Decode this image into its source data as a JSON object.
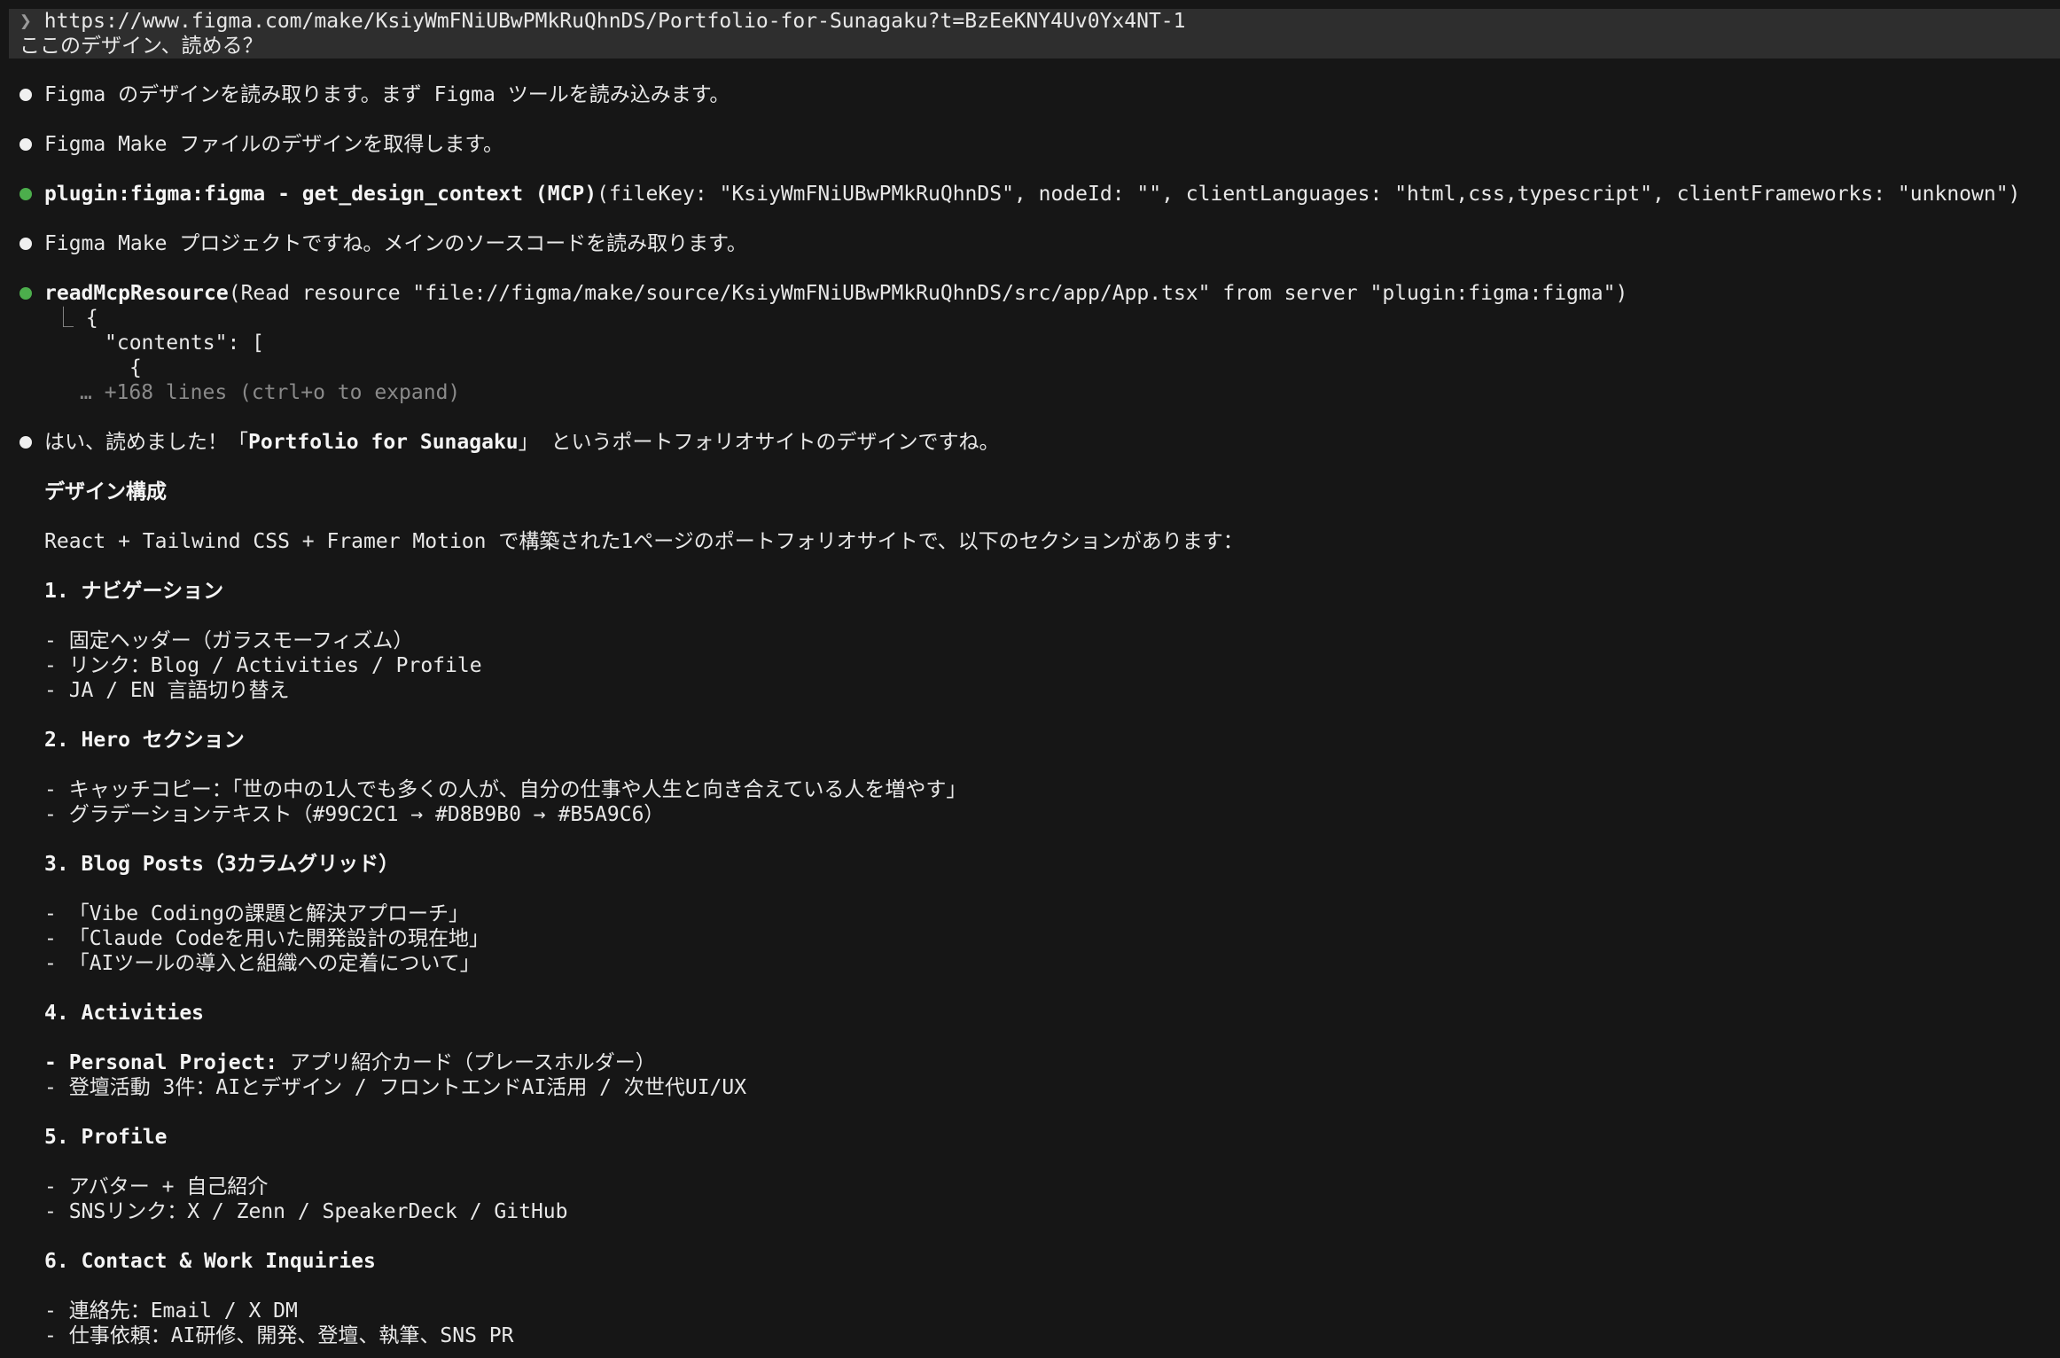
{
  "prompt": {
    "chevron": "❯",
    "url": "https://www.figma.com/make/KsiyWmFNiUBwPMkRuQhnDS/Portfolio-for-Sunagaku?t=BzEeKNY4Uv0Yx4NT-1",
    "question": "ここのデザイン、読める？"
  },
  "messages": [
    "Figma のデザインを読み取ります。まず Figma ツールを読み込みます。",
    "Figma Make ファイルのデザインを取得します。",
    "Figma Make プロジェクトですね。メインのソースコードを読み取ります。"
  ],
  "tool1": {
    "name": "plugin:figma:figma - get_design_context (MCP)",
    "args": "(fileKey: \"KsiyWmFNiUBwPMkRuQhnDS\", nodeId: \"\", clientLanguages: \"html,css,typescript\", clientFrameworks: \"unknown\")"
  },
  "tool2": {
    "name": "readMcpResource",
    "args": "(Read resource \"file://figma/make/source/KsiyWmFNiUBwPMkRuQhnDS/src/app/App.tsx\" from server \"plugin:figma:figma\")",
    "tree_glyph": "⎿",
    "out1": "{",
    "out2": "\"contents\": [",
    "out3": "{",
    "collapsed": "… +168 lines (ctrl+o to expand)"
  },
  "answer": {
    "intro_pre": "はい、読めました！「",
    "intro_bold": "Portfolio for Sunagaku",
    "intro_post": "」 というポートフォリオサイトのデザインですね。",
    "heading": "デザイン構成",
    "summary": "React + Tailwind CSS + Framer Motion で構築された1ページのポートフォリオサイトで、以下のセクションがあります：",
    "s1_title": "1. ナビゲーション",
    "s1_items": [
      "- 固定ヘッダー（ガラスモーフィズム）",
      "- リンク：Blog / Activities / Profile",
      "- JA / EN 言語切り替え"
    ],
    "s2_title": "2. Hero セクション",
    "s2_items": [
      "- キャッチコピー：「世の中の1人でも多くの人が、自分の仕事や人生と向き合えている人を増やす」",
      "- グラデーションテキスト（#99C2C1 → #D8B9B0 → #B5A9C6）"
    ],
    "s3_title": "3. Blog Posts（3カラムグリッド）",
    "s3_items": [
      "- 「Vibe Codingの課題と解決アプローチ」",
      "- 「Claude Codeを用いた開発設計の現在地」",
      "- 「AIツールの導入と組織への定着について」"
    ],
    "s4_title": "4. Activities",
    "s4_item1_bold": "- Personal Project:",
    "s4_item1_rest": " アプリ紹介カード（プレースホルダー）",
    "s4_item2": "- 登壇活動 3件：AIとデザイン / フロントエンドAI活用 / 次世代UI/UX",
    "s5_title": "5. Profile",
    "s5_items": [
      "- アバター + 自己紹介",
      "- SNSリンク：X / Zenn / SpeakerDeck / GitHub"
    ],
    "s6_title": "6. Contact & Work Inquiries",
    "s6_items": [
      "- 連絡先：Email / X DM",
      "- 仕事依頼：AI研修、開発、登壇、執筆、SNS PR"
    ]
  },
  "colors": {
    "background": "#161616",
    "prompt_bg": "#2e2e2e",
    "tool_bullet": "#4cae4c",
    "text": "#e8e8e8",
    "muted": "#8a8a8a"
  }
}
